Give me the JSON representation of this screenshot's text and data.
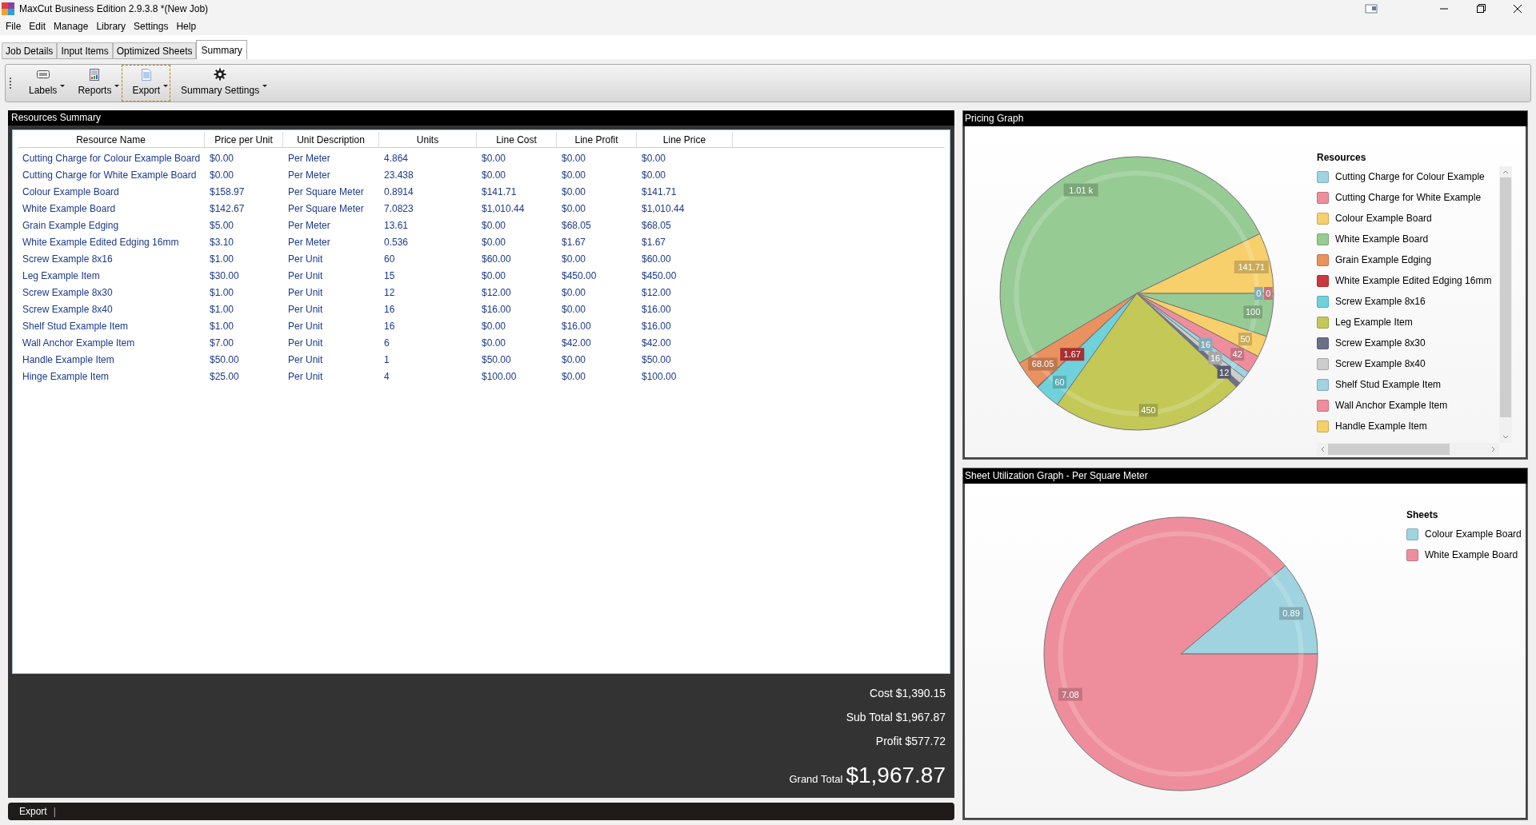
{
  "window": {
    "title": "MaxCut Business Edition 2.9.3.8 *(New Job)"
  },
  "menu": [
    "File",
    "Edit",
    "Manage",
    "Library",
    "Settings",
    "Help"
  ],
  "tabs": [
    {
      "label": "Job Details",
      "selected": false
    },
    {
      "label": "Input Items",
      "selected": false
    },
    {
      "label": "Optimized Sheets",
      "selected": false
    },
    {
      "label": "Summary",
      "selected": true
    }
  ],
  "toolbar": [
    {
      "label": "Labels",
      "focused": false
    },
    {
      "label": "Reports",
      "focused": false
    },
    {
      "label": "Export",
      "focused": true
    },
    {
      "label": "Summary Settings",
      "focused": false
    }
  ],
  "resources_summary": {
    "title": "Resources Summary",
    "columns": [
      "Resource Name",
      "Price per Unit",
      "Unit Description",
      "Units",
      "Line Cost",
      "Line Profit",
      "Line Price"
    ],
    "rows": [
      [
        "Cutting Charge for Colour Example Board",
        "$0.00",
        "Per Meter",
        "4.864",
        "$0.00",
        "$0.00",
        "$0.00"
      ],
      [
        "Cutting Charge for White Example Board",
        "$0.00",
        "Per Meter",
        "23.438",
        "$0.00",
        "$0.00",
        "$0.00"
      ],
      [
        "Colour Example Board",
        "$158.97",
        "Per Square Meter",
        "0.8914",
        "$141.71",
        "$0.00",
        "$141.71"
      ],
      [
        "White Example Board",
        "$142.67",
        "Per Square Meter",
        "7.0823",
        "$1,010.44",
        "$0.00",
        "$1,010.44"
      ],
      [
        "Grain Example Edging",
        "$5.00",
        "Per Meter",
        "13.61",
        "$0.00",
        "$68.05",
        "$68.05"
      ],
      [
        "White Example Edited Edging 16mm",
        "$3.10",
        "Per Meter",
        "0.536",
        "$0.00",
        "$1.67",
        "$1.67"
      ],
      [
        "Screw Example 8x16",
        "$1.00",
        "Per Unit",
        "60",
        "$60.00",
        "$0.00",
        "$60.00"
      ],
      [
        "Leg Example Item",
        "$30.00",
        "Per Unit",
        "15",
        "$0.00",
        "$450.00",
        "$450.00"
      ],
      [
        "Screw Example 8x30",
        "$1.00",
        "Per Unit",
        "12",
        "$12.00",
        "$0.00",
        "$12.00"
      ],
      [
        "Screw Example 8x40",
        "$1.00",
        "Per Unit",
        "16",
        "$16.00",
        "$0.00",
        "$16.00"
      ],
      [
        "Shelf Stud Example Item",
        "$1.00",
        "Per Unit",
        "16",
        "$0.00",
        "$16.00",
        "$16.00"
      ],
      [
        "Wall Anchor Example Item",
        "$7.00",
        "Per Unit",
        "6",
        "$0.00",
        "$42.00",
        "$42.00"
      ],
      [
        "Handle Example Item",
        "$50.00",
        "Per Unit",
        "1",
        "$50.00",
        "$0.00",
        "$50.00"
      ],
      [
        "Hinge Example Item",
        "$25.00",
        "Per Unit",
        "4",
        "$100.00",
        "$0.00",
        "$100.00"
      ]
    ],
    "totals": [
      {
        "label": "Cost",
        "value": "$1,390.15"
      },
      {
        "label": "Sub Total",
        "value": "$1,967.87"
      },
      {
        "label": "Profit",
        "value": "$577.72"
      }
    ],
    "grand_total": {
      "label": "Grand Total",
      "value": "$1,967.87"
    }
  },
  "bottom_bar": {
    "button": "Export",
    "separator": "|"
  },
  "pricing_graph": {
    "title": "Pricing Graph",
    "legend_title": "Resources",
    "legend": [
      {
        "label": "Cutting Charge for Colour Example",
        "color": "#9fd3e0"
      },
      {
        "label": "Cutting Charge for White Example",
        "color": "#ee8e9c"
      },
      {
        "label": "Colour Example Board",
        "color": "#f7cf6b"
      },
      {
        "label": "White Example Board",
        "color": "#97cb94"
      },
      {
        "label": "Grain Example Edging",
        "color": "#e9915f"
      },
      {
        "label": "White Example Edited Edging 16mm",
        "color": "#c9393c"
      },
      {
        "label": "Screw Example 8x16",
        "color": "#6fd2da"
      },
      {
        "label": "Leg Example Item",
        "color": "#c3c857"
      },
      {
        "label": "Screw Example 8x30",
        "color": "#6b7086"
      },
      {
        "label": "Screw Example 8x40",
        "color": "#cdcdcd"
      },
      {
        "label": "Shelf Stud Example Item",
        "color": "#9fd3e0"
      },
      {
        "label": "Wall Anchor Example Item",
        "color": "#ee8e9c"
      },
      {
        "label": "Handle Example Item",
        "color": "#f7cf6b"
      }
    ],
    "chart_data": {
      "type": "pie",
      "values": [
        0,
        0,
        141.71,
        1010.44,
        68.05,
        1.67,
        60,
        450,
        12,
        16,
        16,
        42,
        50,
        100
      ],
      "value_labels": [
        "0",
        "0",
        "141.71",
        "1.01 k",
        "68.05",
        "1.67",
        "60",
        "450",
        "12",
        "16",
        "16",
        "42",
        "50",
        "100"
      ]
    }
  },
  "sheet_graph": {
    "title": "Sheet Utilization Graph - Per Square Meter",
    "legend_title": "Sheets",
    "legend": [
      {
        "label": "Colour Example Board",
        "color": "#9fd3e0"
      },
      {
        "label": "White Example Board",
        "color": "#ee8e9c"
      }
    ],
    "chart_data": {
      "type": "pie",
      "values": [
        0.8914,
        7.0823
      ],
      "value_labels": [
        "0.89",
        "7.08"
      ]
    }
  }
}
